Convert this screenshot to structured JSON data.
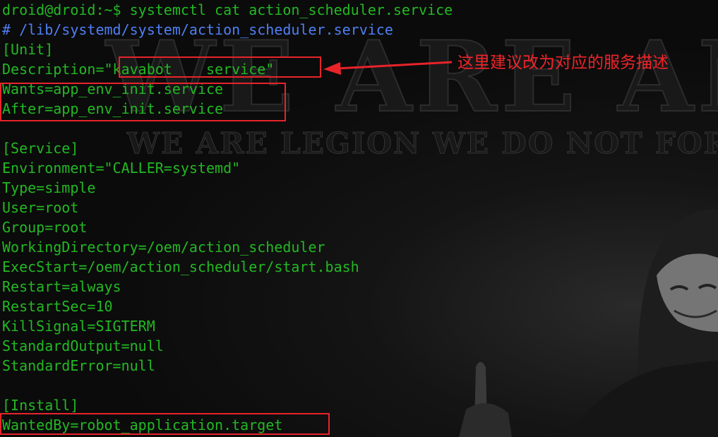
{
  "terminal": {
    "lines": [
      "droid@droid:~$ systemctl cat action_scheduler.service",
      "# /lib/systemd/system/action_scheduler.service",
      "[Unit]",
      "Description=\"kavabot    service\"",
      "Wants=app_env_init.service",
      "After=app_env_init.service",
      "",
      "[Service]",
      "Environment=\"CALLER=systemd\"",
      "Type=simple",
      "User=root",
      "Group=root",
      "WorkingDirectory=/oem/action_scheduler",
      "ExecStart=/oem/action_scheduler/start.bash",
      "Restart=always",
      "RestartSec=10",
      "KillSignal=SIGTERM",
      "StandardOutput=null",
      "StandardError=null",
      "",
      "[Install]",
      "WantedBy=robot_application.target"
    ]
  },
  "annotation": {
    "note": "这里建议改为对应的服务描述"
  },
  "wallpaper": {
    "big_text": "WE ARE AN",
    "sub_text": "WE ARE LEGION WE DO NOT FORGIVE"
  },
  "colors": {
    "text_green": "#23b823",
    "comment_blue": "#4f7ff4",
    "annotation_red": "#e8232a",
    "background": "#0b0b0b"
  }
}
